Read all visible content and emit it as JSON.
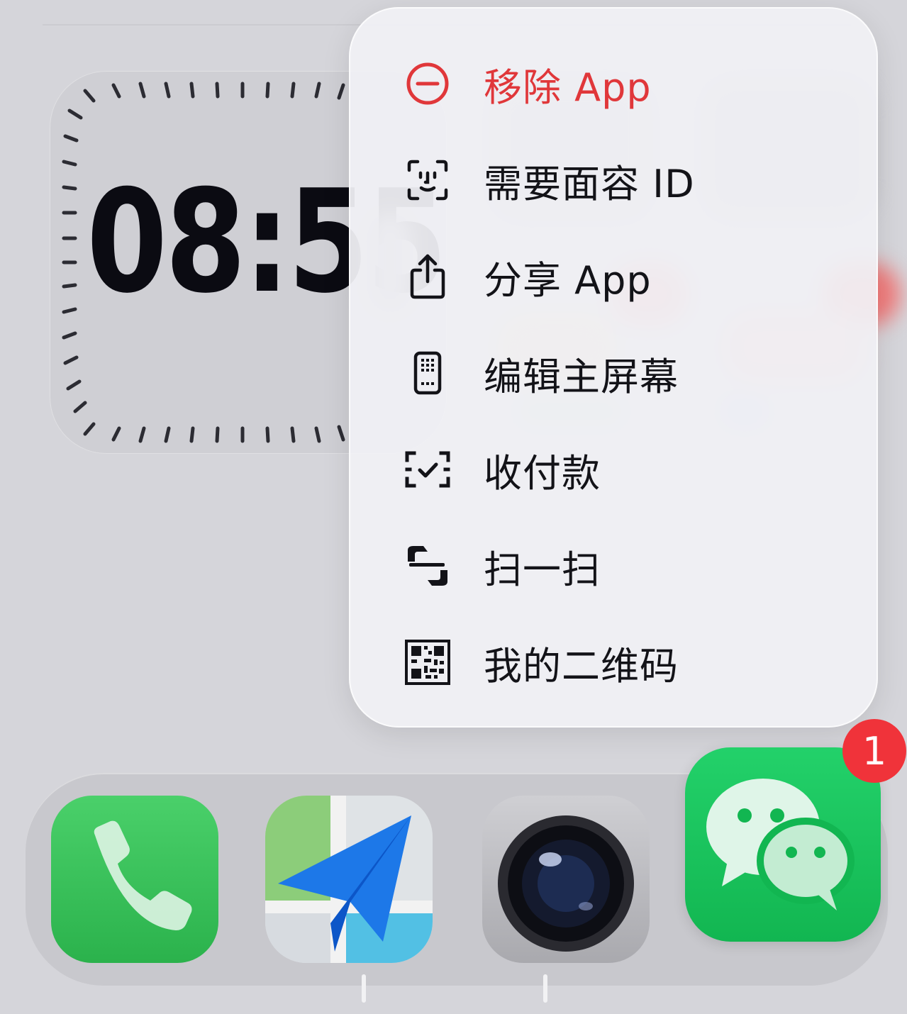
{
  "clock": {
    "time": "08:55"
  },
  "menu": {
    "items": [
      {
        "icon": "minus-circle-icon",
        "label": "移除 App",
        "destructive": true
      },
      {
        "icon": "face-id-icon",
        "label": "需要面容 ID"
      },
      {
        "icon": "share-icon",
        "label": "分享 App"
      },
      {
        "icon": "phone-grid-icon",
        "label": "编辑主屏幕"
      },
      {
        "icon": "payment-scan-icon",
        "label": "收付款"
      },
      {
        "icon": "scan-icon",
        "label": "扫一扫"
      },
      {
        "icon": "qr-code-icon",
        "label": "我的二维码"
      }
    ]
  },
  "dock": {
    "apps": [
      {
        "name": "phone",
        "icon": "phone-icon"
      },
      {
        "name": "maps",
        "icon": "paper-plane-map-icon"
      },
      {
        "name": "camera",
        "icon": "camera-lens-icon"
      },
      {
        "name": "wechat",
        "icon": "wechat-bubbles-icon",
        "badge": "1"
      }
    ]
  },
  "colors": {
    "destructive": "#e0373a",
    "badge": "#f0333a",
    "wechat_green": "#12b651",
    "phone_green": "#2bb24c"
  }
}
